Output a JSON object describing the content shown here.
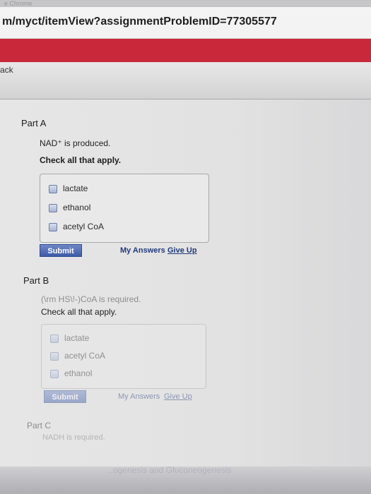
{
  "browser": {
    "tab_fragment": "e Chrome",
    "url": "m/myct/itemView?assignmentProblemID=77305577",
    "back_label": "ack"
  },
  "part_a": {
    "title": "Part A",
    "prompt": "NAD⁺ is produced.",
    "instruction": "Check all that apply.",
    "options": [
      "lactate",
      "ethanol",
      "acetyl CoA"
    ],
    "submit": "Submit",
    "my_answers": "My Answers",
    "give_up": "Give Up"
  },
  "part_b": {
    "title": "Part B",
    "prompt": "(\\rm HS\\!-)CoA is required.",
    "instruction": "Check all that apply.",
    "options": [
      "lactate",
      "acetyl CoA",
      "ethanol"
    ],
    "submit": "Submit",
    "my_answers": "My Answers",
    "give_up": "Give Up"
  },
  "part_c": {
    "title": "Part C",
    "prompt": "NADH is required."
  },
  "footer": {
    "text": "...ogenesis and Gluconeogenesis"
  }
}
